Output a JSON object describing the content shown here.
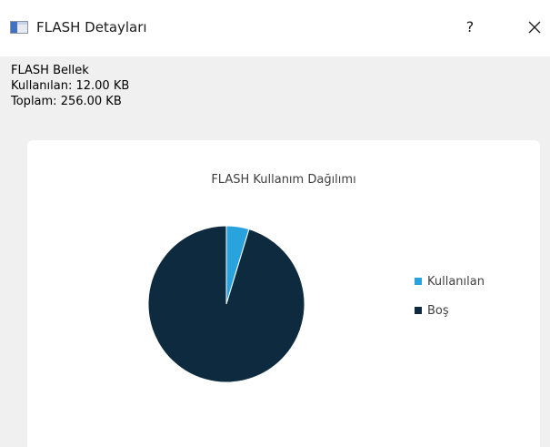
{
  "window": {
    "title": "FLASH Detayları",
    "icon": "window-app-icon",
    "help_label": "?",
    "close_icon": "close-icon"
  },
  "info": {
    "heading": "FLASH Bellek",
    "used_line": "Kullanılan: 12.00 KB",
    "total_line": "Toplam: 256.00 KB"
  },
  "colors": {
    "used": "#29a3dd",
    "free": "#0d2a3e"
  },
  "chart_data": {
    "type": "pie",
    "title": "FLASH Kullanım Dağılımı",
    "categories": [
      "Kullanılan",
      "Boş"
    ],
    "values": [
      12.0,
      244.0
    ],
    "units": "KB",
    "legend_position": "right"
  }
}
